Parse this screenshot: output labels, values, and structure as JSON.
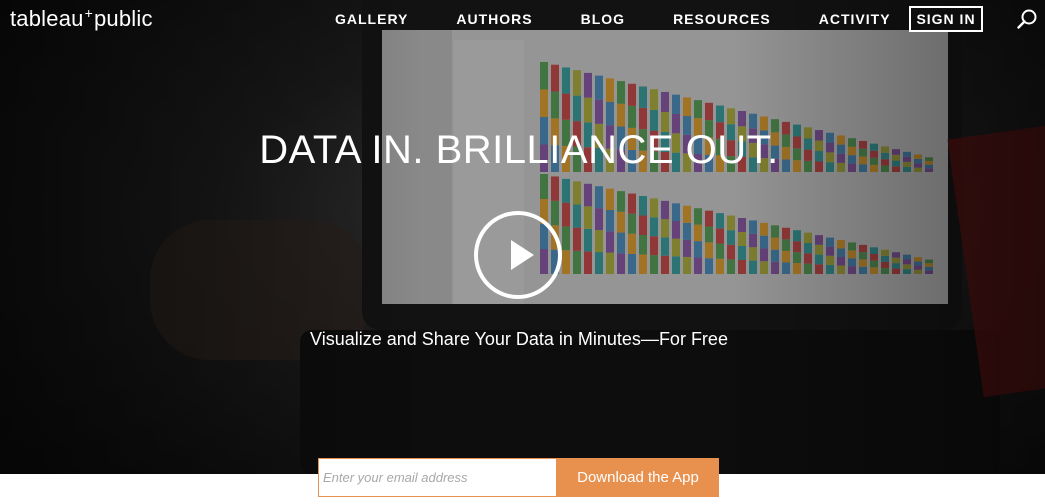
{
  "brand": {
    "logo_left": "tableau",
    "logo_plus": "+",
    "logo_right": "public"
  },
  "nav": {
    "items": [
      {
        "label": "GALLERY"
      },
      {
        "label": "AUTHORS"
      },
      {
        "label": "BLOG"
      },
      {
        "label": "RESOURCES"
      },
      {
        "label": "ACTIVITY"
      }
    ],
    "signin_label": "SIGN IN",
    "search_icon": "search-icon"
  },
  "hero": {
    "headline": "DATA IN. BRILLIANCE OUT.",
    "subhead_main": "Visualize and Share Your Data in Minutes—",
    "subhead_emphasis": "For Free",
    "play_icon": "play-icon"
  },
  "signup": {
    "email_placeholder": "Enter your email address",
    "email_value": "",
    "button_label": "Download the App"
  },
  "colors": {
    "accent": "#e8904e",
    "text_light": "#ffffff"
  }
}
